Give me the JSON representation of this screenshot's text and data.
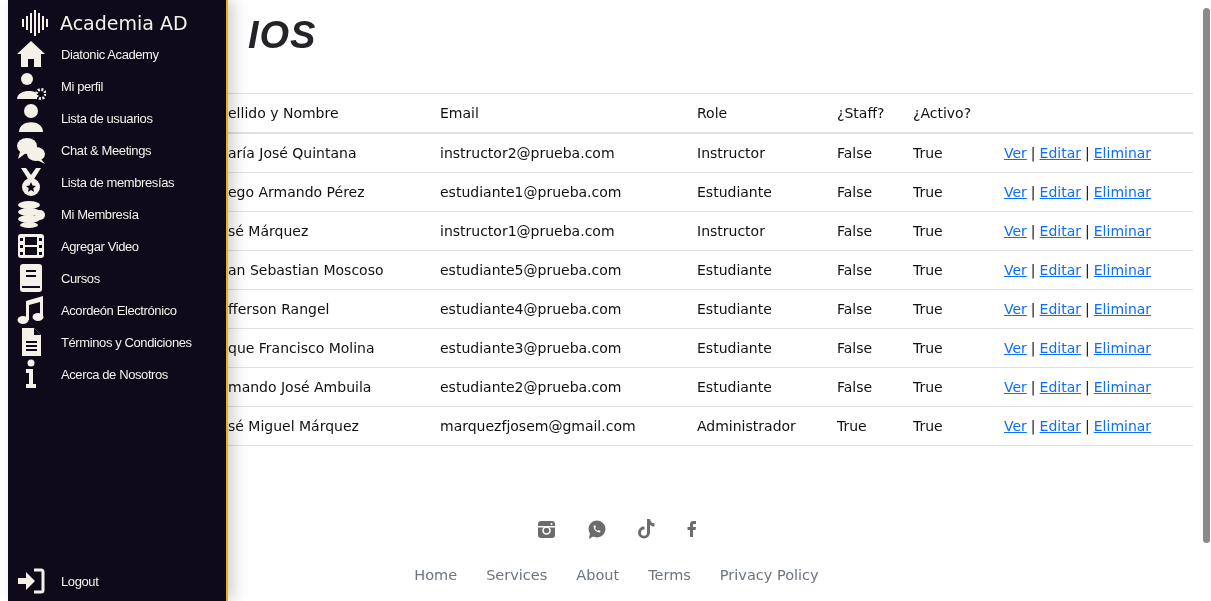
{
  "sidebar": {
    "brand": "Academia AD",
    "items": [
      {
        "label": "Diatonic Academy"
      },
      {
        "label": "Mi perfil"
      },
      {
        "label": "Lista de usuarios"
      },
      {
        "label": "Chat & Meetings"
      },
      {
        "label": "Lista de membresías"
      },
      {
        "label": "Mi Membresía"
      },
      {
        "label": "Agregar Video"
      },
      {
        "label": "Cursos"
      },
      {
        "label": "Acordeón Electrónico"
      },
      {
        "label": "Términos y Condiciones"
      },
      {
        "label": "Acerca de Nosotros"
      }
    ],
    "logout": "Logout"
  },
  "page_title": "IOS",
  "table": {
    "columns": [
      "ellido y Nombre",
      "Email",
      "Role",
      "¿Staff?",
      "¿Activo?"
    ],
    "rows": [
      {
        "name": "aría José Quintana",
        "email": "instructor2@prueba.com",
        "role": "Instructor",
        "staff": "False",
        "active": "True",
        "actions": [
          "Ver",
          "|",
          "Editar",
          "|",
          "Eliminar"
        ]
      },
      {
        "name": "ego Armando Pérez",
        "email": "estudiante1@prueba.com",
        "role": "Estudiante",
        "staff": "False",
        "active": "True",
        "actions": [
          "Ver",
          "|",
          "Editar",
          "|",
          "Eliminar"
        ]
      },
      {
        "name": "sé Márquez",
        "email": "instructor1@prueba.com",
        "role": "Instructor",
        "staff": "False",
        "active": "True",
        "actions": [
          "Ver",
          "|",
          "Editar",
          "|",
          "Eliminar"
        ]
      },
      {
        "name": "an Sebastian Moscoso",
        "email": "estudiante5@prueba.com",
        "role": "Estudiante",
        "staff": "False",
        "active": "True",
        "actions": [
          "Ver",
          "|",
          "Editar",
          "|",
          "Eliminar"
        ]
      },
      {
        "name": "fferson Rangel",
        "email": "estudiante4@prueba.com",
        "role": "Estudiante",
        "staff": "False",
        "active": "True",
        "actions": [
          "Ver",
          "|",
          "Editar",
          "|",
          "Eliminar"
        ]
      },
      {
        "name": "que Francisco Molina",
        "email": "estudiante3@prueba.com",
        "role": "Estudiante",
        "staff": "False",
        "active": "True",
        "actions": [
          "Ver",
          "|",
          "Editar",
          "|",
          "Eliminar"
        ]
      },
      {
        "name": "mando José Ambuila",
        "email": "estudiante2@prueba.com",
        "role": "Estudiante",
        "staff": "False",
        "active": "True",
        "actions": [
          "Ver",
          "|",
          "Editar",
          "|",
          "Eliminar"
        ]
      },
      {
        "name": "sé Miguel Márquez",
        "email": "marquezfjosem@gmail.com",
        "role": "Administrador",
        "staff": "True",
        "active": "True",
        "actions": [
          "Ver",
          "|",
          "Editar",
          "|",
          "Eliminar"
        ]
      }
    ]
  },
  "footer": {
    "links": [
      "Home",
      "Services",
      "About",
      "Terms",
      "Privacy Policy"
    ]
  }
}
